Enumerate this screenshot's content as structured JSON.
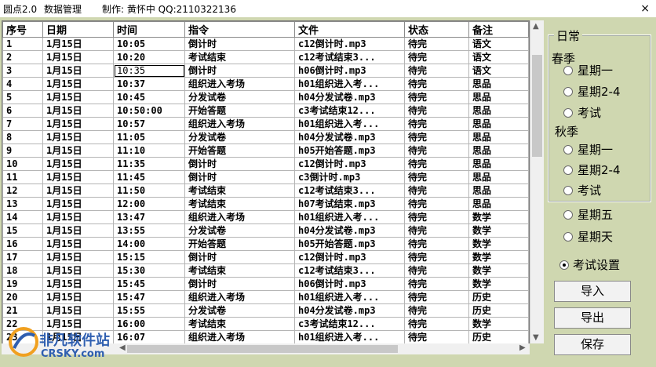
{
  "menubar": {
    "app": "圆点2.0",
    "data_mgmt": "数据管理",
    "author": "制作: 黄怀中 QQ:2110322136",
    "close": "×"
  },
  "table": {
    "headers": [
      "序号",
      "日期",
      "时间",
      "指令",
      "文件",
      "状态",
      "备注"
    ],
    "rows": [
      [
        "1",
        "1月15日",
        "10:05",
        "倒计时",
        "c12倒计时.mp3",
        "待完",
        "语文"
      ],
      [
        "2",
        "1月15日",
        "10:20",
        "考试结束",
        "c12考试结束3...",
        "待完",
        "语文"
      ],
      [
        "3",
        "1月15日",
        "10:35",
        "倒计时",
        "h06倒计时.mp3",
        "待完",
        "语文"
      ],
      [
        "4",
        "1月15日",
        "10:37",
        "组织进入考场",
        "h01组织进入考...",
        "待完",
        "思品"
      ],
      [
        "5",
        "1月15日",
        "10:45",
        "分发试卷",
        "h04分发试卷.mp3",
        "待完",
        "思品"
      ],
      [
        "6",
        "1月15日",
        "10:50:00",
        "开始答题",
        "c3考试结束12...",
        "待完",
        "思品"
      ],
      [
        "7",
        "1月15日",
        "10:57",
        "组织进入考场",
        "h01组织进入考...",
        "待完",
        "思品"
      ],
      [
        "8",
        "1月15日",
        "11:05",
        "分发试卷",
        "h04分发试卷.mp3",
        "待完",
        "思品"
      ],
      [
        "9",
        "1月15日",
        "11:10",
        "开始答题",
        "h05开始答题.mp3",
        "待完",
        "思品"
      ],
      [
        "10",
        "1月15日",
        "11:35",
        "倒计时",
        "c12倒计时.mp3",
        "待完",
        "思品"
      ],
      [
        "11",
        "1月15日",
        "11:45",
        "倒计时",
        "c3倒计时.mp3",
        "待完",
        "思品"
      ],
      [
        "12",
        "1月15日",
        "11:50",
        "考试结束",
        "c12考试结束3...",
        "待完",
        "思品"
      ],
      [
        "13",
        "1月15日",
        "12:00",
        "考试结束",
        "h07考试结束.mp3",
        "待完",
        "思品"
      ],
      [
        "14",
        "1月15日",
        "13:47",
        "组织进入考场",
        "h01组织进入考...",
        "待完",
        "数学"
      ],
      [
        "15",
        "1月15日",
        "13:55",
        "分发试卷",
        "h04分发试卷.mp3",
        "待完",
        "数学"
      ],
      [
        "16",
        "1月15日",
        "14:00",
        "开始答题",
        "h05开始答题.mp3",
        "待完",
        "数学"
      ],
      [
        "17",
        "1月15日",
        "15:15",
        "倒计时",
        "c12倒计时.mp3",
        "待完",
        "数学"
      ],
      [
        "18",
        "1月15日",
        "15:30",
        "考试结束",
        "c12考试结束3...",
        "待完",
        "数学"
      ],
      [
        "19",
        "1月15日",
        "15:45",
        "倒计时",
        "h06倒计时.mp3",
        "待完",
        "数学"
      ],
      [
        "20",
        "1月15日",
        "15:47",
        "组织进入考场",
        "h01组织进入考...",
        "待完",
        "历史"
      ],
      [
        "21",
        "1月15日",
        "15:55",
        "分发试卷",
        "h04分发试卷.mp3",
        "待完",
        "历史"
      ],
      [
        "22",
        "1月15日",
        "16:00",
        "考试结束",
        "c3考试结束12...",
        "待完",
        "数学"
      ],
      [
        "23",
        "1月15日",
        "16:07",
        "组织进入考场",
        "h01组织进入考...",
        "待完",
        "历史"
      ]
    ],
    "editing_row": 2,
    "editing_col": 2
  },
  "panel": {
    "group_title": "日常",
    "spring": "春季",
    "spring_options": [
      "星期一",
      "星期2-4",
      "考试"
    ],
    "autumn": "秋季",
    "autumn_options": [
      "星期一",
      "星期2-4",
      "考试"
    ],
    "fri": "星期五",
    "sun": "星期天",
    "exam_settings": "考试设置",
    "selected": "考试设置"
  },
  "buttons": {
    "import": "导入",
    "export": "导出",
    "save": "保存"
  },
  "watermark": {
    "line1": "非凡软件站",
    "line2": "CRSKY.com"
  },
  "colors": {
    "background": "#cfd7b0",
    "watermark": "#2f5fb0"
  }
}
